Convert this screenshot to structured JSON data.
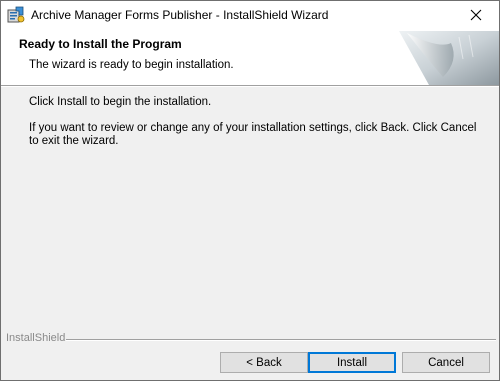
{
  "window": {
    "title": "Archive Manager Forms Publisher - InstallShield Wizard"
  },
  "header": {
    "title": "Ready to Install the Program",
    "subtitle": "The wizard is ready to begin installation."
  },
  "body": {
    "line1": "Click Install to begin the installation.",
    "line2": "If you want to review or change any of your installation settings, click Back. Click Cancel to exit the wizard."
  },
  "footer": {
    "brand": "InstallShield",
    "back_label": "< Back",
    "install_label": "Install",
    "cancel_label": "Cancel"
  },
  "icons": {
    "app": "installer-icon",
    "close": "close-icon",
    "banner": "curled-page-graphic"
  },
  "colors": {
    "dialog_bg": "#f0f0f0",
    "header_bg": "#ffffff",
    "default_button_border": "#0078d7",
    "brand_text": "#8a8a8a"
  }
}
